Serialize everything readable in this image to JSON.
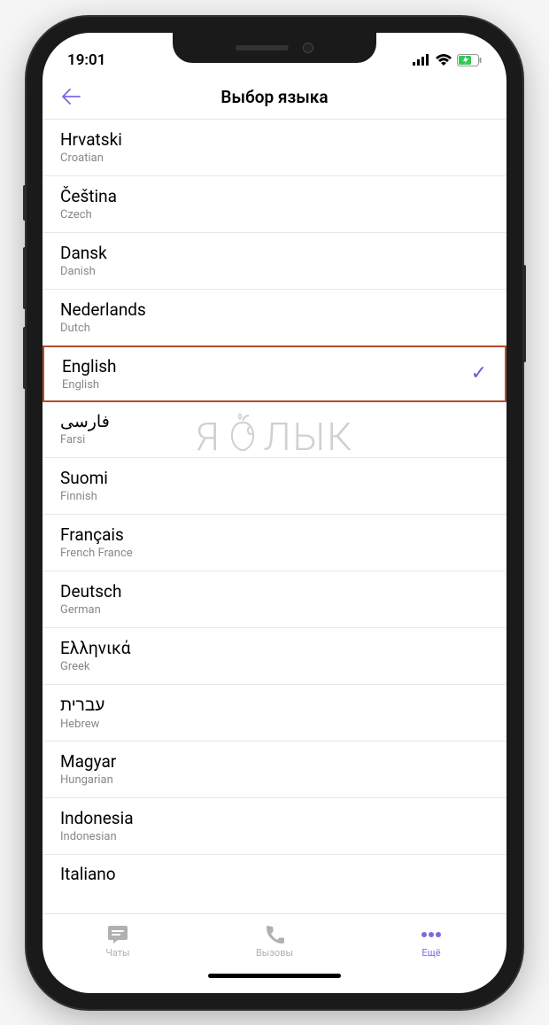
{
  "statusBar": {
    "time": "19:01"
  },
  "header": {
    "title": "Выбор языка"
  },
  "languages": [
    {
      "native": "Hrvatski",
      "english": "Croatian",
      "selected": false
    },
    {
      "native": "Čeština",
      "english": "Czech",
      "selected": false
    },
    {
      "native": "Dansk",
      "english": "Danish",
      "selected": false
    },
    {
      "native": "Nederlands",
      "english": "Dutch",
      "selected": false
    },
    {
      "native": "English",
      "english": "English",
      "selected": true
    },
    {
      "native": "فارسى",
      "english": "Farsi",
      "selected": false
    },
    {
      "native": "Suomi",
      "english": "Finnish",
      "selected": false
    },
    {
      "native": "Français",
      "english": "French France",
      "selected": false
    },
    {
      "native": "Deutsch",
      "english": "German",
      "selected": false
    },
    {
      "native": "Ελληνικά",
      "english": "Greek",
      "selected": false
    },
    {
      "native": "עברית",
      "english": "Hebrew",
      "selected": false
    },
    {
      "native": "Magyar",
      "english": "Hungarian",
      "selected": false
    },
    {
      "native": "Indonesia",
      "english": "Indonesian",
      "selected": false
    },
    {
      "native": "Italiano",
      "english": "",
      "selected": false
    }
  ],
  "tabs": {
    "chats": "Чаты",
    "calls": "Вызовы",
    "more": "Ещё"
  },
  "watermark": {
    "left": "Я",
    "right": "ЛЫК"
  },
  "colors": {
    "accent": "#7a6be0",
    "highlight_border": "#b84a2e"
  }
}
